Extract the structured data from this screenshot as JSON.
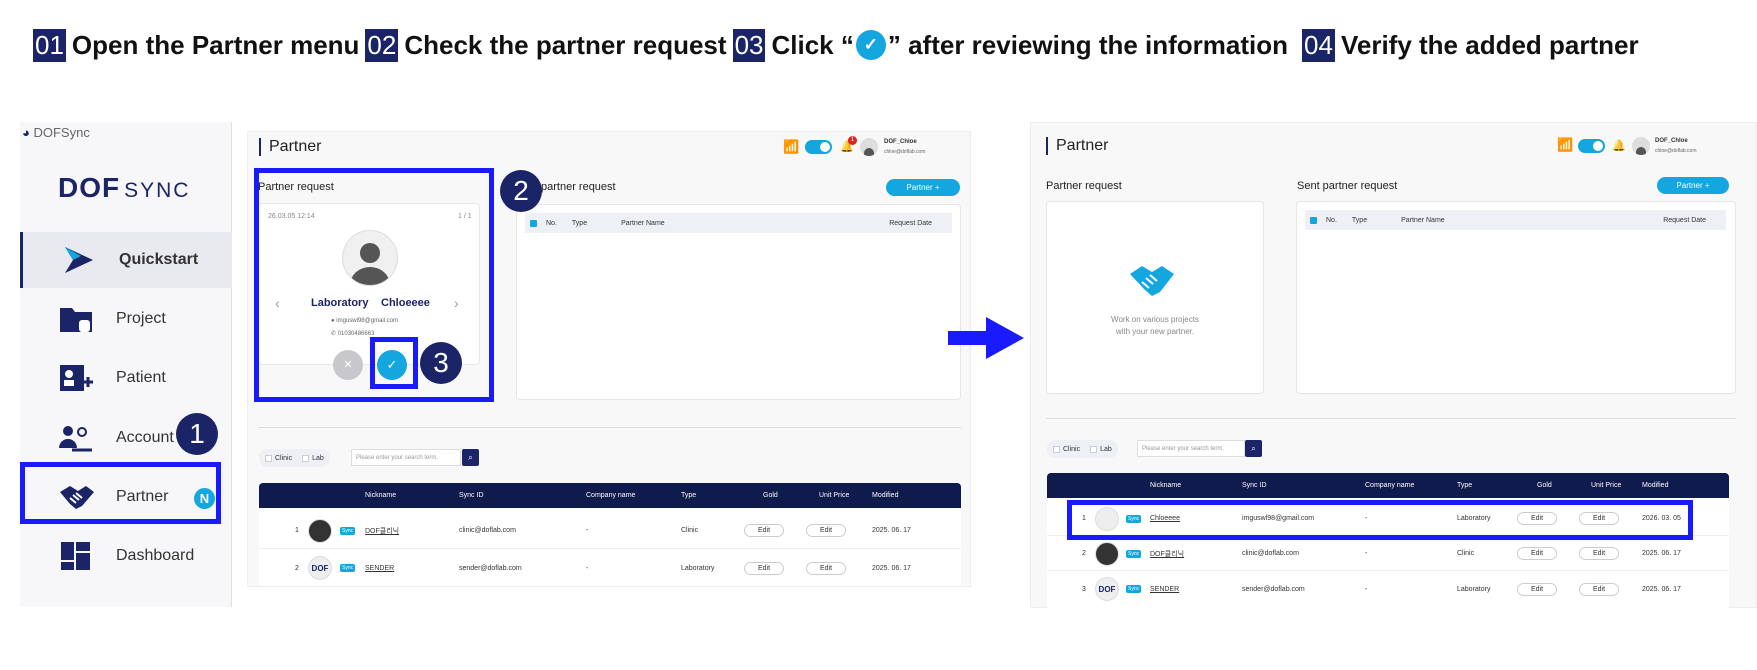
{
  "steps": [
    {
      "num": "01",
      "text": "Open the Partner menu"
    },
    {
      "num": "02",
      "text": "Check the partner request"
    },
    {
      "num": "03",
      "pre": "Click “",
      "post": "” after reviewing the information"
    },
    {
      "num": "04",
      "text": "Verify the added partner"
    }
  ],
  "sidebar": {
    "app_name": "DOFSync",
    "logo": {
      "main": "DOF",
      "sub": "SYNC"
    },
    "items": [
      {
        "label": "Quickstart",
        "icon": "quickstart-icon"
      },
      {
        "label": "Project",
        "icon": "folder-icon"
      },
      {
        "label": "Patient",
        "icon": "patient-icon"
      },
      {
        "label": "Account",
        "icon": "account-icon"
      },
      {
        "label": "Partner",
        "icon": "handshake-icon",
        "badge": "N"
      },
      {
        "label": "Dashboard",
        "icon": "dashboard-icon"
      }
    ]
  },
  "callouts": [
    "1",
    "2",
    "3"
  ],
  "screen1": {
    "title": "Partner",
    "notif_count": "1",
    "user": {
      "name": "DOF_Chloe",
      "email": "chloe@doflab.com"
    },
    "request_title": "Partner request",
    "sent_title": "partner request",
    "partner_button": "Partner +",
    "card": {
      "date": "26.03.05 12:14",
      "page": "1 / 1",
      "type": "Laboratory",
      "name": "Chloeeee",
      "email": "imguswl98@gmail.com",
      "phone": "01030486663"
    },
    "sent_headers": [
      "No.",
      "Type",
      "Partner Name",
      "Request Date"
    ],
    "filters": [
      "Clinic",
      "Lab"
    ],
    "search_placeholder": "Please enter your search term.",
    "table_headers": [
      "Nickname",
      "Sync ID",
      "Company name",
      "Type",
      "Gold",
      "Unit Price",
      "Modified"
    ],
    "rows": [
      {
        "no": "1",
        "thumb": "",
        "nickname": "DOF클리닉",
        "sync_id": "clinic@doflab.com",
        "company": "-",
        "type": "Clinic",
        "gold": "Edit",
        "unit": "Edit",
        "modified": "2025. 06. 17"
      },
      {
        "no": "2",
        "thumb": "DOF",
        "nickname": "SENDER",
        "sync_id": "sender@doflab.com",
        "company": "-",
        "type": "Laboratory",
        "gold": "Edit",
        "unit": "Edit",
        "modified": "2025. 06. 17"
      }
    ]
  },
  "screen2": {
    "title": "Partner",
    "user": {
      "name": "DOF_Chloe",
      "email": "chloe@doflab.com"
    },
    "request_title": "Partner request",
    "sent_title": "Sent partner request",
    "partner_button": "Partner +",
    "empty_text": [
      "Work on various projects",
      "with your new partner."
    ],
    "sent_headers": [
      "No.",
      "Type",
      "Partner Name",
      "Request Date"
    ],
    "filters": [
      "Clinic",
      "Lab"
    ],
    "search_placeholder": "Please enter your search term.",
    "table_headers": [
      "Nickname",
      "Sync ID",
      "Company name",
      "Type",
      "Gold",
      "Unit Price",
      "Modified"
    ],
    "rows": [
      {
        "no": "1",
        "thumb": "",
        "nickname": "Chloeeee",
        "sync_id": "imguswl98@gmail.com",
        "company": "-",
        "type": "Laboratory",
        "gold": "Edit",
        "unit": "Edit",
        "modified": "2026. 03. 05"
      },
      {
        "no": "2",
        "thumb": "",
        "nickname": "DOF클리닉",
        "sync_id": "clinic@doflab.com",
        "company": "-",
        "type": "Clinic",
        "gold": "Edit",
        "unit": "Edit",
        "modified": "2025. 06. 17"
      },
      {
        "no": "3",
        "thumb": "DOF",
        "nickname": "SENDER",
        "sync_id": "sender@doflab.com",
        "company": "-",
        "type": "Laboratory",
        "gold": "Edit",
        "unit": "Edit",
        "modified": "2025. 06. 17"
      }
    ]
  },
  "colors": {
    "accent": "#13a6df",
    "navy": "#1a2466",
    "highlight": "#1a1aff"
  }
}
